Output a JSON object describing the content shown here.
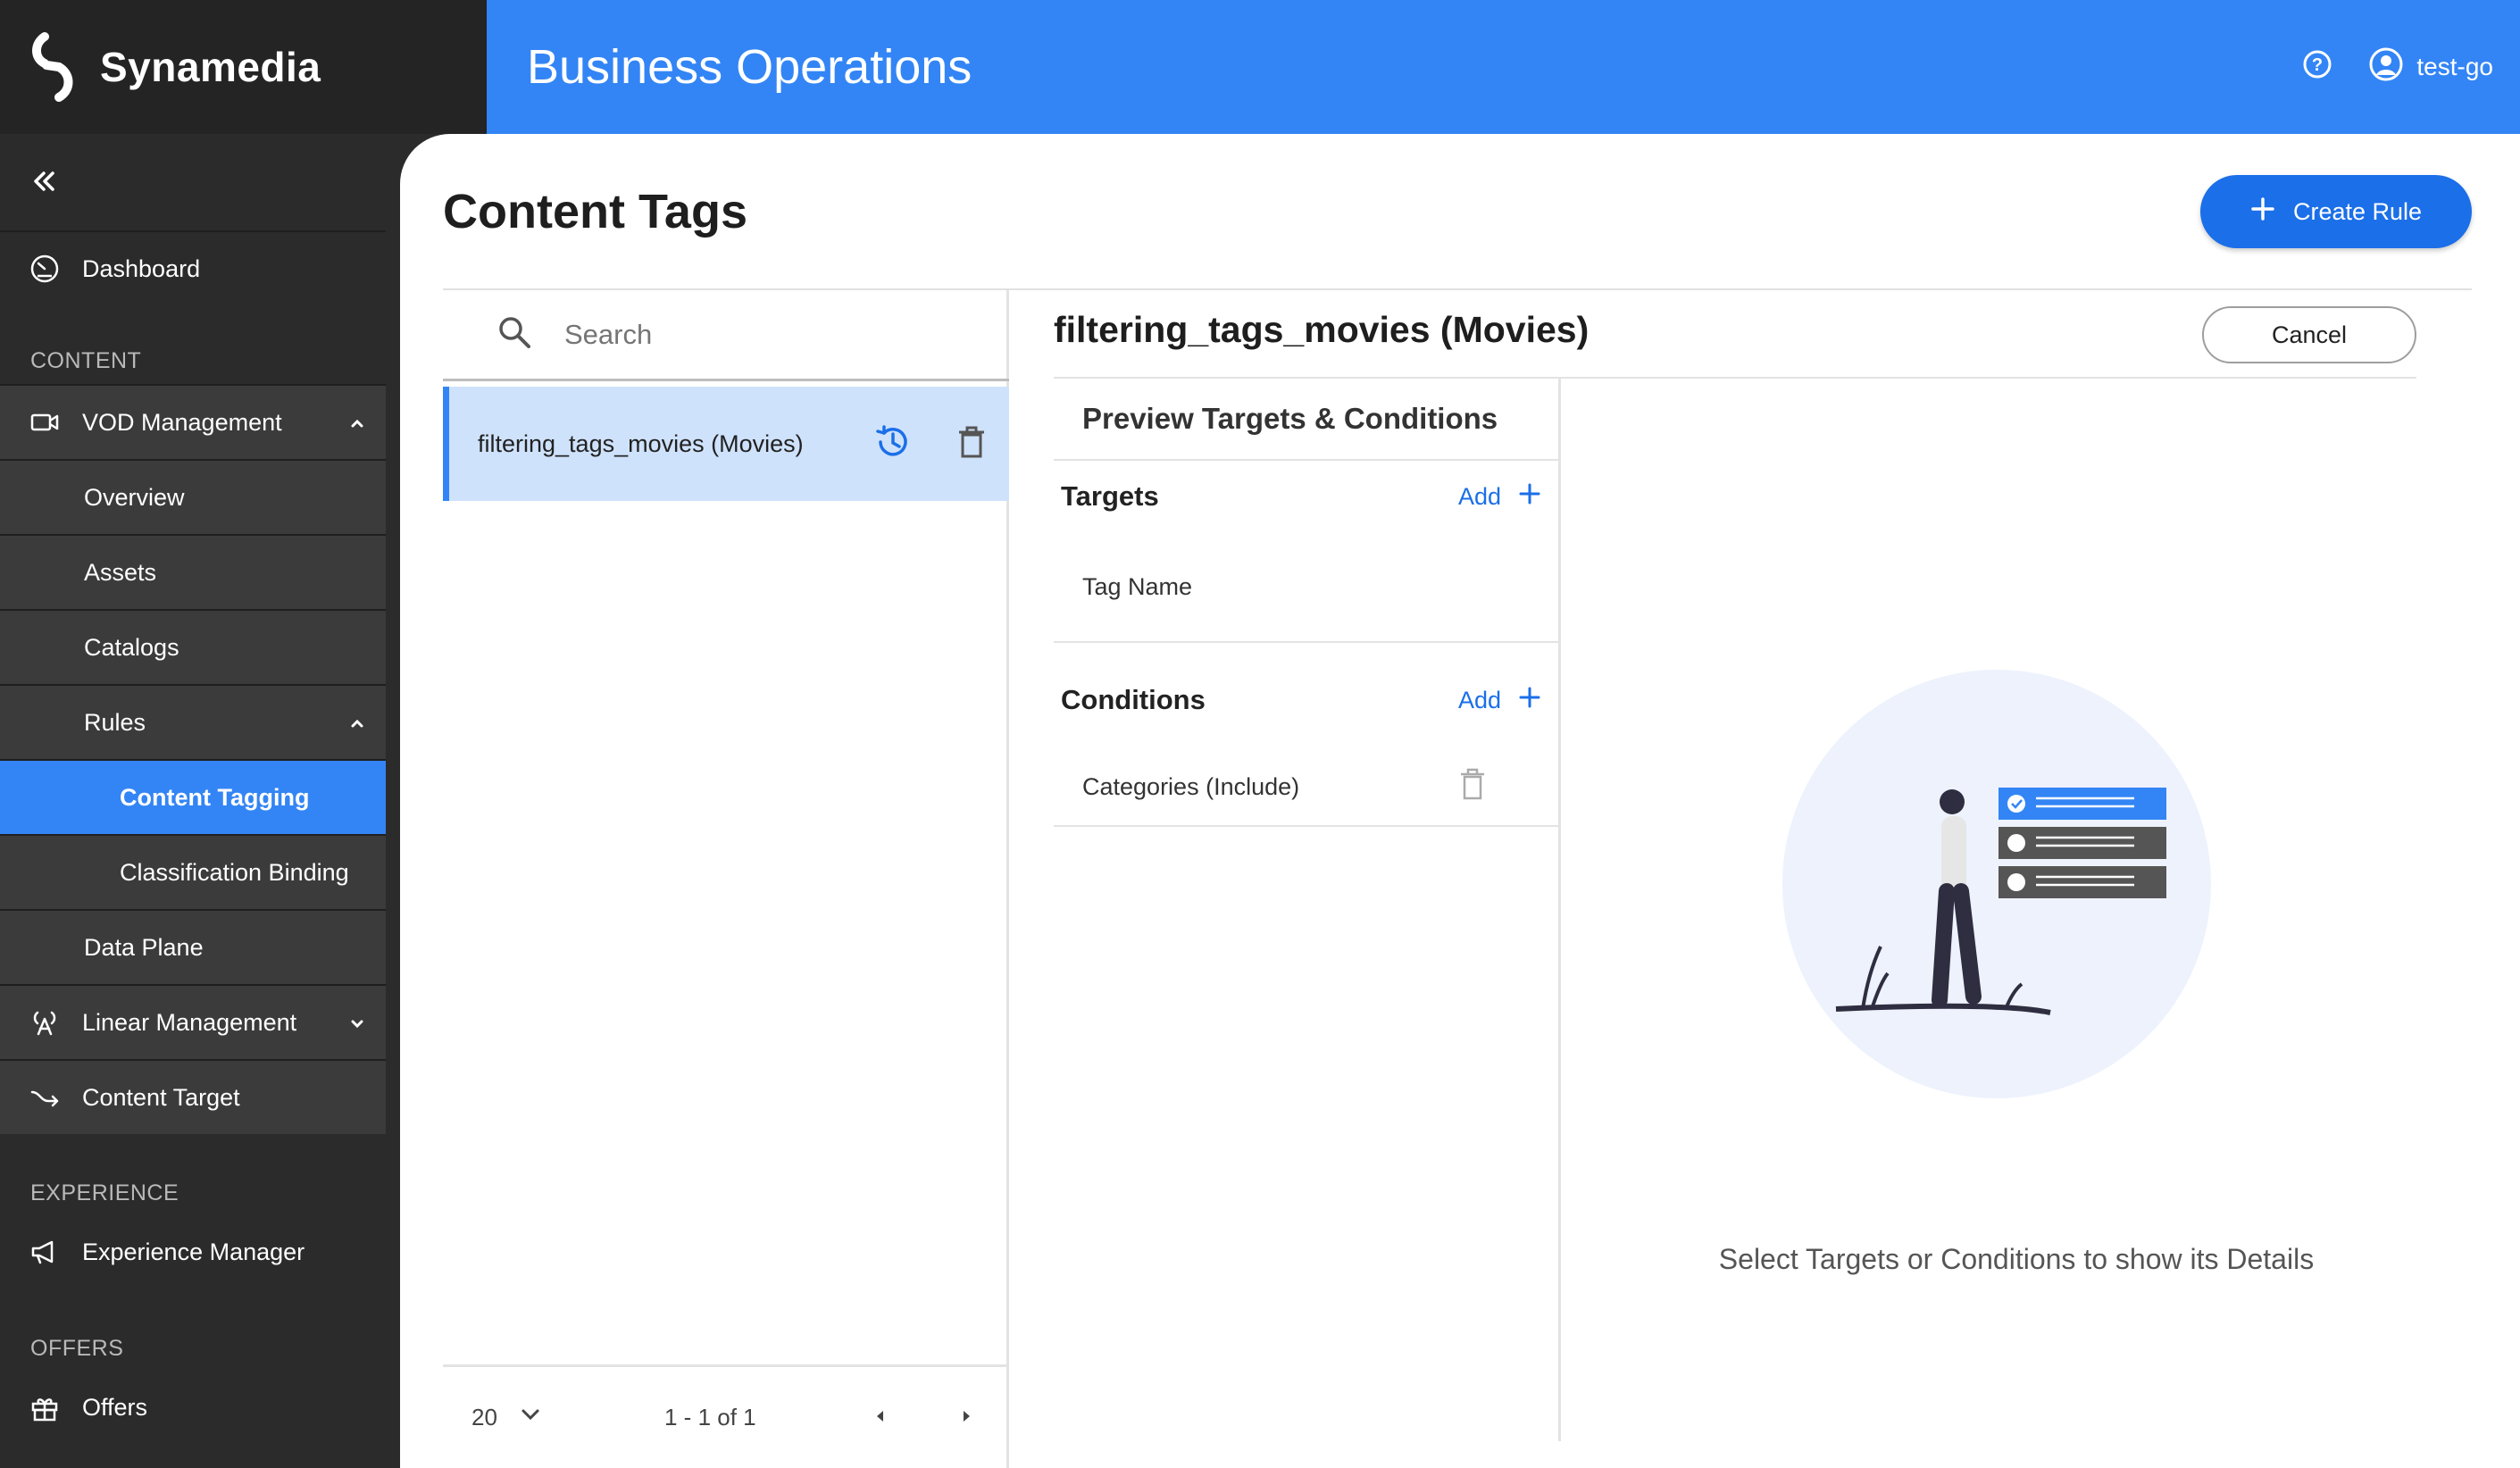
{
  "brand": {
    "name": "Synamedia"
  },
  "header": {
    "title": "Business Operations",
    "user": "test-go"
  },
  "sidebar": {
    "items": {
      "dashboard": "Dashboard",
      "vod_management": "VOD Management",
      "overview": "Overview",
      "assets": "Assets",
      "catalogs": "Catalogs",
      "rules": "Rules",
      "content_tagging": "Content Tagging",
      "classification_binding": "Classification Binding",
      "data_plane": "Data Plane",
      "linear_management": "Linear Management",
      "content_target": "Content Target",
      "experience_manager": "Experience Manager",
      "offers": "Offers"
    },
    "sections": {
      "content": "CONTENT",
      "experience": "EXPERIENCE",
      "offers": "OFFERS"
    }
  },
  "main": {
    "title": "Content Tags",
    "create_button": "Create Rule",
    "search_placeholder": "Search",
    "list": [
      {
        "name": "filtering_tags_movies (Movies)"
      }
    ],
    "pager": {
      "page_size": "20",
      "range": "1 - 1 of 1"
    }
  },
  "detail": {
    "title": "filtering_tags_movies (Movies)",
    "cancel": "Cancel",
    "preview_heading": "Preview Targets & Conditions",
    "targets_heading": "Targets",
    "targets_add": "Add",
    "target_item": "Tag Name",
    "conditions_heading": "Conditions",
    "conditions_add": "Add",
    "condition_item": "Categories (Include)",
    "empty_message": "Select Targets or Conditions to show its Details"
  },
  "colors": {
    "accent": "#3385f5",
    "primary_button": "#1b6fe8",
    "sidebar": "#2b2b2b",
    "selected_row": "#cfe2fb"
  },
  "icons": [
    "logo-icon",
    "help-icon",
    "user-icon",
    "collapse-icon",
    "dashboard-icon",
    "video-icon",
    "broadcast-icon",
    "arrow-out-icon",
    "megaphone-icon",
    "gift-icon",
    "search-icon",
    "history-icon",
    "trash-icon",
    "plus-icon",
    "chevron-down-icon",
    "chevron-up-icon",
    "caret-left-icon",
    "caret-right-icon"
  ]
}
